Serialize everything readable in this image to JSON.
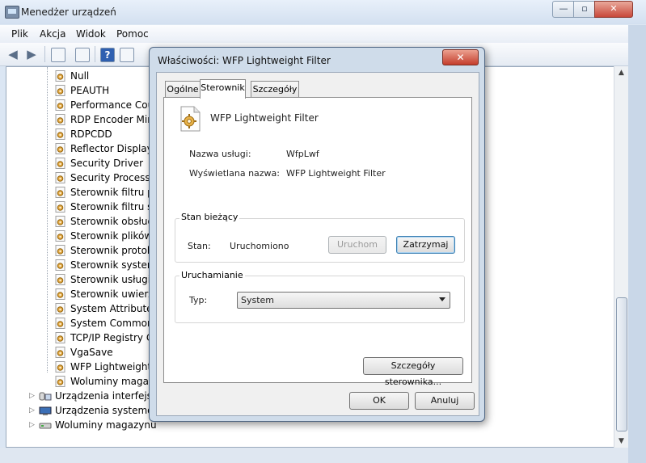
{
  "window": {
    "title": "Menedżer urządzeń",
    "caption_min": "—",
    "caption_max": "▫",
    "caption_close": "✕"
  },
  "menu": [
    "Plik",
    "Akcja",
    "Widok",
    "Pomoc"
  ],
  "toolbar": {
    "back": "◀",
    "forward": "▶",
    "help": "?"
  },
  "tree": {
    "drivers": [
      "Null",
      "PEAUTH",
      "Performance Coun",
      "RDP Encoder Mirro",
      "RDPCDD",
      "Reflector Display D",
      "Security Driver",
      "Security Processor",
      "Sterownik filtru prz",
      "Sterownik filtru szy",
      "Sterownik obsługi s",
      "Sterownik plików o",
      "Sterownik protoko",
      "Sterownik systemo",
      "Sterownik usługi D",
      "Sterownik uwierzyt",
      "System Attribute C",
      "System Common L",
      "TCP/IP Registry Co",
      "VgaSave",
      "WFP Lightweight F",
      "Woluminy magazy"
    ],
    "categories": [
      "Urządzenia interfejsu H",
      "Urządzenia systemowe",
      "Woluminy magazynu"
    ]
  },
  "scrollbar": {
    "up": "▲",
    "down": "▼"
  },
  "dialog": {
    "title": "Właściwości: WFP Lightweight Filter",
    "close": "✕",
    "tabs": {
      "general": "Ogólne",
      "driver": "Sterownik",
      "details": "Szczegóły"
    },
    "driver_name": "WFP Lightweight Filter",
    "service_name_label": "Nazwa usługi:",
    "service_name_value": "WfpLwf",
    "display_name_label": "Wyświetlana nazwa:",
    "display_name_value": "WFP Lightweight Filter",
    "current_state_group": "Stan bieżący",
    "state_label": "Stan:",
    "state_value": "Uruchomiono",
    "start_button": "Uruchom",
    "stop_button": "Zatrzymaj",
    "startup_group": "Uruchamianie",
    "type_label": "Typ:",
    "type_value": "System",
    "driver_details_button": "Szczegóły sterownika...",
    "ok_button": "OK",
    "cancel_button": "Anuluj"
  }
}
